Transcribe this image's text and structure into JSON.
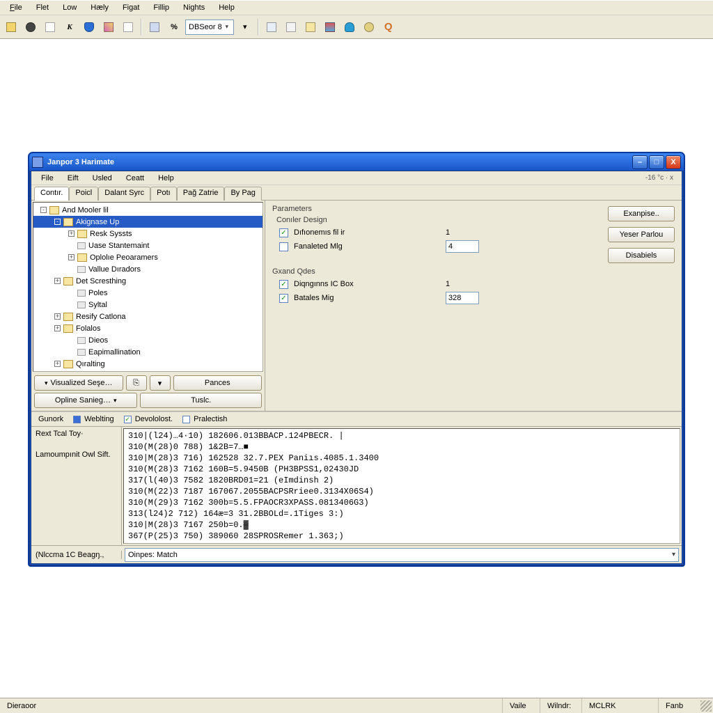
{
  "host_menu": {
    "file": "File",
    "flet": "Flet",
    "low": "Low",
    "help_alt": "Hæly",
    "figat": "Figat",
    "fillip": "Fillip",
    "nights": "Nights",
    "help": "Help"
  },
  "host_toolbar": {
    "combo_value": "DBSeor  8"
  },
  "child": {
    "title": "Janpor 3 Harimate",
    "menu": {
      "file": "File",
      "eift": "Eift",
      "usled": "Usled",
      "ceatt": "Ceatt",
      "help": "Help"
    },
    "status_top_right": "-16 °c · x",
    "tabs": [
      "Contır.",
      "Poicl",
      "Dalant Syrc",
      "Potı",
      "Pağ Zatrie",
      "By Pag"
    ],
    "tree": [
      {
        "label": "And Mooler lil",
        "indent": 0,
        "twisty": "-",
        "icon": "folder"
      },
      {
        "label": "Akignase Up",
        "indent": 1,
        "twisty": "-",
        "icon": "folder",
        "selected": true
      },
      {
        "label": "Resk Syssts",
        "indent": 2,
        "twisty": "+",
        "icon": "folder"
      },
      {
        "label": "Uase Stantemaint",
        "indent": 2,
        "twisty": "",
        "icon": "tag"
      },
      {
        "label": "Oplolıe Peoaramers",
        "indent": 2,
        "twisty": "+",
        "icon": "folder"
      },
      {
        "label": "Vallue Dıradors",
        "indent": 2,
        "twisty": "",
        "icon": "tag"
      },
      {
        "label": "Det Scresthing",
        "indent": 1,
        "twisty": "+",
        "icon": "folder"
      },
      {
        "label": "Poles",
        "indent": 2,
        "twisty": "",
        "icon": "tag"
      },
      {
        "label": "Syltal",
        "indent": 2,
        "twisty": "",
        "icon": "tag"
      },
      {
        "label": "Resify Catlona",
        "indent": 1,
        "twisty": "+",
        "icon": "folder"
      },
      {
        "label": "Folalos",
        "indent": 1,
        "twisty": "+",
        "icon": "folder"
      },
      {
        "label": "Dieos",
        "indent": 2,
        "twisty": "",
        "icon": "tag"
      },
      {
        "label": "Eapimallination",
        "indent": 2,
        "twisty": "",
        "icon": "tag"
      },
      {
        "label": "Qıralting",
        "indent": 1,
        "twisty": "+",
        "icon": "folder"
      }
    ],
    "tree_buttons": {
      "visual_set": "Visualized Seşe…",
      "pances": "Pances",
      "opline": "Opline Sanieg…",
      "tuslc": "Tuslc."
    },
    "parameters": {
      "header": "Parameters",
      "group1_title": "Conıler Design",
      "g1": [
        {
          "label": "Dıfıonemıs fil ir",
          "checked": true,
          "value": "1",
          "input": false
        },
        {
          "label": "Fanaleted Mlg",
          "checked": false,
          "value": "4",
          "input": true
        }
      ],
      "group2_title": "Gxand Qdes",
      "g2": [
        {
          "label": "Diqngınns IC Box",
          "checked": true,
          "value": "1",
          "input": false
        },
        {
          "label": "Batales Mig",
          "checked": true,
          "value": "328",
          "input": true
        }
      ]
    },
    "side_buttons": {
      "eampise": "Exanpise..",
      "yeser": "Yeser Parlou",
      "disabiels": "Disabiels"
    },
    "log_tabs": {
      "gunork": "Gunork",
      "weblting": "Weblting",
      "devololost": "Devololost.",
      "pralectish": "Pralectish"
    },
    "log_left": {
      "rext": "Rext Tcal Toy·",
      "amount": "Lamoumpınit Owl Sift."
    },
    "log_lines": [
      "310|(l24)…4·10) 182606.013BBACP.124PBECR. |",
      "310(M(28)0 788) 1&2B=7…■",
      "310|M(28)3 716) 162528 32.7.PEX Paniıs.4085.1.3400",
      "310(M(28)3 7162 160B=5.9450B (PH3BPSS1,02430JD",
      "317(l(40)3 7582 1820BRD01=21 (eImdinsh 2)",
      "310(M(22)3 7187 167067.2055BACPSRriee0.3134X06S4)",
      "310(M(29)3 7162 300b=5.5.FPAOCR3XPASS.0813406G3)",
      "313(l24)2 712) 164æ=3 31.2BBOLd=.1Tiges 3:)",
      "310|M(28)3 7167 250b=0.▓",
      "367(P(25)3 750) 389060 28SPROSRemer 1.363;)"
    ],
    "bottom_left": "(Nlccma 1C Beagŋ.,",
    "bottom_combo": "Oinpes: Match"
  },
  "host_status": {
    "dieraoor": "Dieraoor",
    "vaile": "Vaile",
    "windr": "Wilndr:",
    "mclrk": "MCLRK",
    "fanb": "Fanb"
  },
  "colors": {
    "xp_blue": "#1a56c9",
    "bg_classic": "#ece9d8"
  }
}
